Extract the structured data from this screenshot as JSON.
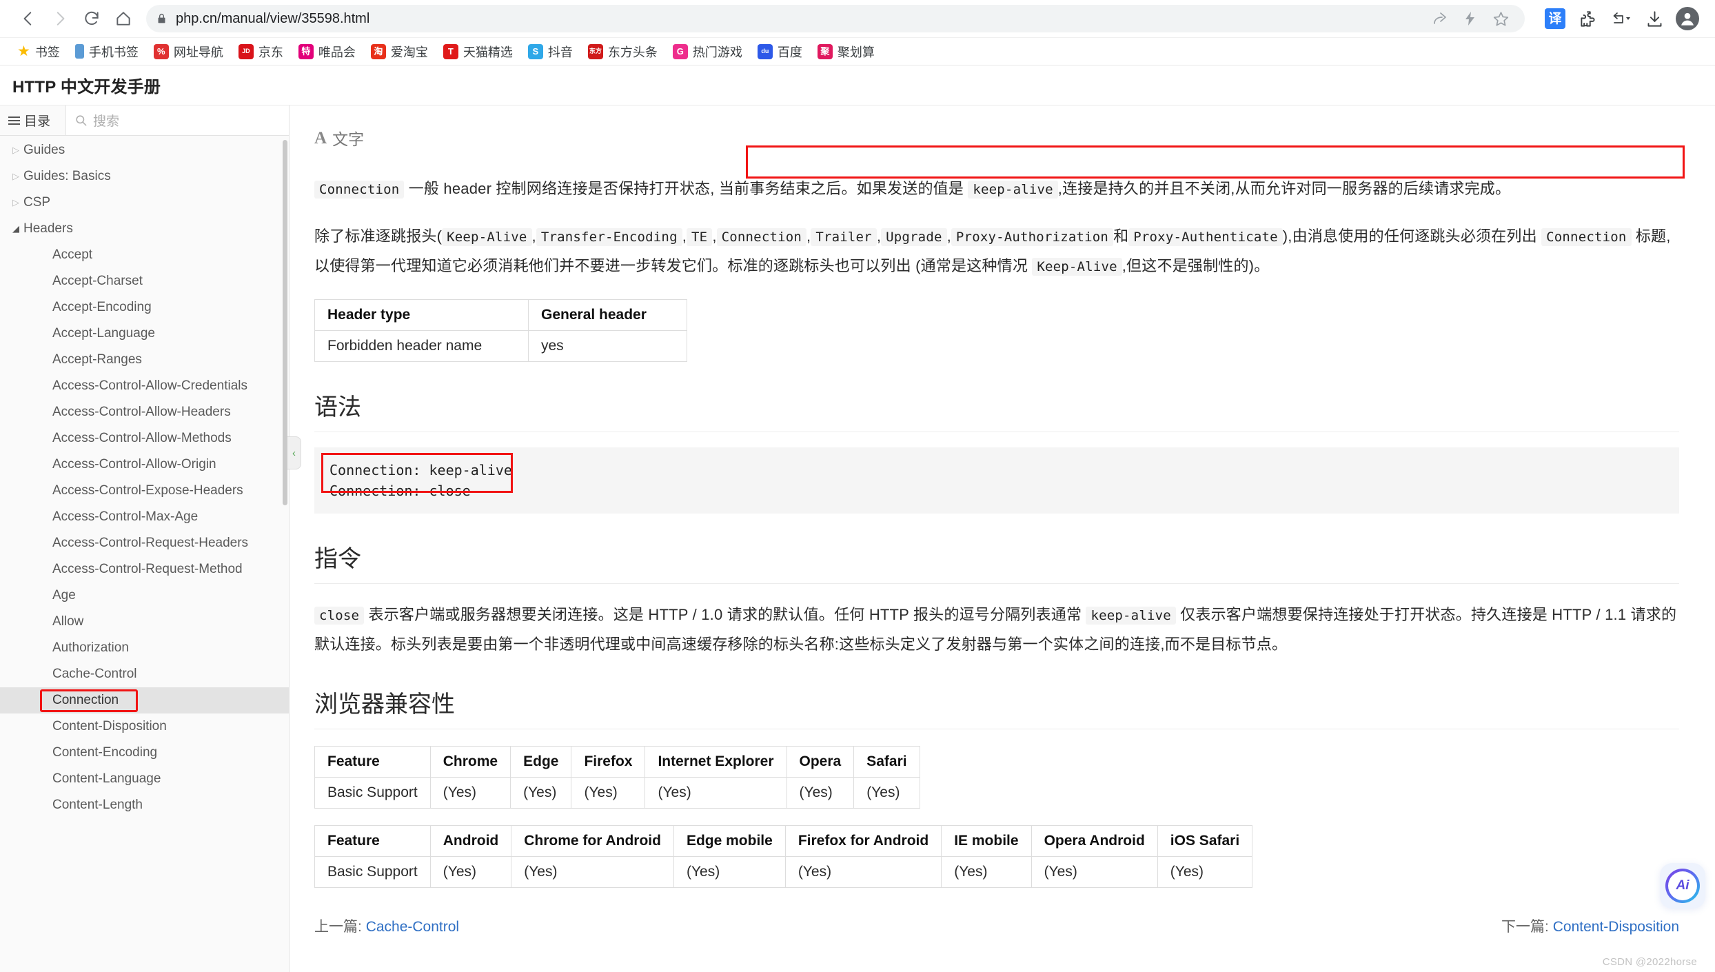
{
  "browser": {
    "url": "php.cn/manual/view/35598.html",
    "nav": {
      "back": "back-arrow",
      "forward": "forward-arrow",
      "reload": "reload",
      "home": "home"
    },
    "omnibox_actions": [
      "share-icon",
      "lightning-icon",
      "star-icon"
    ],
    "toolbar_right": [
      {
        "name": "translate-icon",
        "label": "译"
      },
      {
        "name": "extensions-puzzle-icon",
        "label": ""
      },
      {
        "name": "history-back-dropdown-icon",
        "label": ""
      },
      {
        "name": "downloads-icon",
        "label": ""
      },
      {
        "name": "profile-avatar-icon",
        "label": ""
      }
    ]
  },
  "bookmarks": [
    {
      "label": "书签",
      "icon": "star",
      "color": "#fbbc04"
    },
    {
      "label": "手机书签",
      "icon": "phone",
      "color": "#5b9bd5"
    },
    {
      "label": "网址导航",
      "icon": "text",
      "glyph": "%",
      "color": "#e03131"
    },
    {
      "label": "京东",
      "icon": "text",
      "glyph": "JD",
      "color": "#d9131a"
    },
    {
      "label": "唯品会",
      "icon": "text",
      "glyph": "特",
      "color": "#e2007a"
    },
    {
      "label": "爱淘宝",
      "icon": "text",
      "glyph": "淘",
      "color": "#e8301a"
    },
    {
      "label": "天猫精选",
      "icon": "text",
      "glyph": "T",
      "color": "#e01a1a"
    },
    {
      "label": "抖音",
      "icon": "text",
      "glyph": "S",
      "color": "#2fa8e8"
    },
    {
      "label": "东方头条",
      "icon": "text",
      "glyph": "东方",
      "color": "#d01a1a"
    },
    {
      "label": "热门游戏",
      "icon": "text",
      "glyph": "G",
      "color": "#ee2d8c"
    },
    {
      "label": "百度",
      "icon": "text",
      "glyph": "du",
      "color": "#2d59e8"
    },
    {
      "label": "聚划算",
      "icon": "text",
      "glyph": "聚",
      "color": "#e0195e"
    }
  ],
  "site": {
    "title": "HTTP 中文开发手册"
  },
  "sidebar": {
    "tab_toc": "目录",
    "search_placeholder": "搜索",
    "items": [
      {
        "label": "Guides",
        "level": 1,
        "expandable": true,
        "expanded": false
      },
      {
        "label": "Guides: Basics",
        "level": 1,
        "expandable": true,
        "expanded": false
      },
      {
        "label": "CSP",
        "level": 1,
        "expandable": true,
        "expanded": false
      },
      {
        "label": "Headers",
        "level": 1,
        "expandable": true,
        "expanded": true
      },
      {
        "label": "Accept",
        "level": 2
      },
      {
        "label": "Accept-Charset",
        "level": 2
      },
      {
        "label": "Accept-Encoding",
        "level": 2
      },
      {
        "label": "Accept-Language",
        "level": 2
      },
      {
        "label": "Accept-Ranges",
        "level": 2
      },
      {
        "label": "Access-Control-Allow-Credentials",
        "level": 2
      },
      {
        "label": "Access-Control-Allow-Headers",
        "level": 2
      },
      {
        "label": "Access-Control-Allow-Methods",
        "level": 2
      },
      {
        "label": "Access-Control-Allow-Origin",
        "level": 2
      },
      {
        "label": "Access-Control-Expose-Headers",
        "level": 2
      },
      {
        "label": "Access-Control-Max-Age",
        "level": 2
      },
      {
        "label": "Access-Control-Request-Headers",
        "level": 2
      },
      {
        "label": "Access-Control-Request-Method",
        "level": 2
      },
      {
        "label": "Age",
        "level": 2
      },
      {
        "label": "Allow",
        "level": 2
      },
      {
        "label": "Authorization",
        "level": 2
      },
      {
        "label": "Cache-Control",
        "level": 2
      },
      {
        "label": "Connection",
        "level": 2,
        "active": true,
        "annotated": true
      },
      {
        "label": "Content-Disposition",
        "level": 2
      },
      {
        "label": "Content-Encoding",
        "level": 2
      },
      {
        "label": "Content-Language",
        "level": 2
      },
      {
        "label": "Content-Length",
        "level": 2
      }
    ]
  },
  "content": {
    "font_control_label": "文字",
    "font_control_glyph": "A",
    "para1": {
      "code": "Connection",
      "text_before_box": " 一般 header 控制网络连接是否保持打开状态,",
      "boxed_part1": "当前事务结束之后。如果发送的值是 ",
      "boxed_code": "keep-alive",
      "boxed_part2": ",连接是持久的并且不关闭,从而允许对同一服务器的后续请求完成。"
    },
    "para2": {
      "s1": "除了标准逐跳报头(",
      "c1": "Keep-Alive",
      "s2": ",",
      "c2": "Transfer-Encoding",
      "s3": ",",
      "c3": "TE",
      "s4": ",",
      "c4": "Connection",
      "s5": ",",
      "c5": "Trailer",
      "s6": ",",
      "c6": "Upgrade",
      "s7": ",",
      "c7": "Proxy-Authorization",
      "s8": "和",
      "c8": "Proxy-Authenticate",
      "s9": "),由消息使用的任何逐跳头必须在列出 ",
      "c9": "Connection",
      "s10": " 标题,以使得第一代理知道它必须消耗他们并不要进一步转发它们。标准的逐跳标头也可以列出 (通常是这种情况 ",
      "c10": "Keep-Alive",
      "s11": ",但这不是强制性的)。"
    },
    "header_table": {
      "headers": [
        "Header type",
        "General header"
      ],
      "rows": [
        [
          "Forbidden header name",
          "yes"
        ]
      ]
    },
    "syntax": {
      "heading": "语法",
      "code": "Connection: keep-alive\nConnection: close"
    },
    "directives": {
      "heading": "指令",
      "c1": "close",
      "s1": " 表示客户端或服务器想要关闭连接。这是 HTTP / 1.0 请求的默认值。任何 HTTP 报头的逗号分隔列表通常 ",
      "c2": "keep-alive",
      "s2": " 仅表示客户端想要保持连接处于打开状态。持久连接是 HTTP / 1.1 请求的默认连接。标头列表是要由第一个非透明代理或中间高速缓存移除的标头名称:这些标头定义了发射器与第一个实体之间的连接,而不是目标节点。"
    },
    "compat": {
      "heading": "浏览器兼容性",
      "desktop": {
        "headers": [
          "Feature",
          "Chrome",
          "Edge",
          "Firefox",
          "Internet Explorer",
          "Opera",
          "Safari"
        ],
        "rows": [
          [
            "Basic Support",
            "(Yes)",
            "(Yes)",
            "(Yes)",
            "(Yes)",
            "(Yes)",
            "(Yes)"
          ]
        ]
      },
      "mobile": {
        "headers": [
          "Feature",
          "Android",
          "Chrome for Android",
          "Edge mobile",
          "Firefox for Android",
          "IE mobile",
          "Opera Android",
          "iOS Safari"
        ],
        "rows": [
          [
            "Basic Support",
            "(Yes)",
            "(Yes)",
            "(Yes)",
            "(Yes)",
            "(Yes)",
            "(Yes)",
            "(Yes)"
          ]
        ]
      }
    },
    "footer": {
      "prev_label": "上一篇:",
      "prev_link": "Cache-Control",
      "next_label": "下一篇:",
      "next_link": "Content-Disposition"
    },
    "watermark": "CSDN @2022horse",
    "ai_button": "Ai"
  },
  "colors": {
    "annotation_red": "#f11414",
    "link_blue": "#2f6fc4",
    "accent_blue": "#2d7ff9"
  }
}
